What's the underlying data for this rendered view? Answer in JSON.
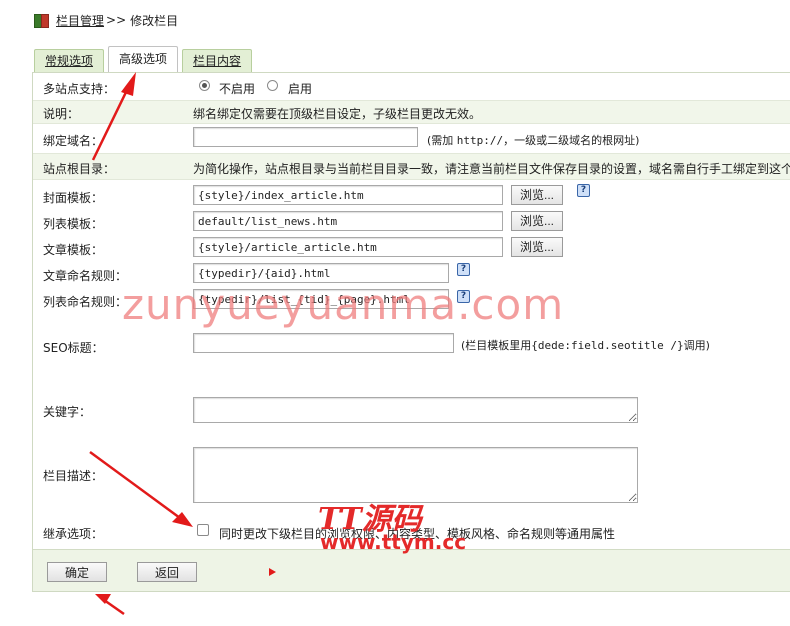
{
  "breadcrumb": {
    "parent": "栏目管理",
    "separator": ">>",
    "current": "修改栏目"
  },
  "tabs": [
    {
      "label": "常规选项"
    },
    {
      "label": "高级选项"
    },
    {
      "label": "栏目内容"
    }
  ],
  "active_tab": "高级选项",
  "form": {
    "multisite": {
      "label": "多站点支持：",
      "options": [
        "不启用",
        "启用"
      ],
      "selected": "不启用"
    },
    "note": {
      "label": "说明：",
      "text": "绑名绑定仅需要在顶级栏目设定，子级栏目更改无效。"
    },
    "bind_domain": {
      "label": "绑定域名：",
      "value": "",
      "hint_prefix": "(需加 ",
      "hint_code": "http://",
      "hint_suffix": "，一级或二级域名的根网址)"
    },
    "site_root": {
      "label": "站点根目录：",
      "text": "为简化操作，站点根目录与当前栏目目录一致，请注意当前栏目文件保存目录的设置，域名需自行手工绑定到这个"
    },
    "cover_template": {
      "label": "封面模板：",
      "value": "{style}/index_article.htm",
      "browse": "浏览..."
    },
    "list_template": {
      "label": "列表模板：",
      "value": "default/list_news.htm",
      "browse": "浏览..."
    },
    "article_template": {
      "label": "文章模板：",
      "value": "{style}/article_article.htm",
      "browse": "浏览..."
    },
    "article_rule": {
      "label": "文章命名规则：",
      "value": "{typedir}/{aid}.html"
    },
    "list_rule": {
      "label": "列表命名规则：",
      "value": "{typedir}/list_{tid}_{page}.html"
    },
    "seo_title": {
      "label": "SEO标题：",
      "value": "",
      "hint_prefix": "(栏目模板里用",
      "hint_code": "{dede:field.seotitle /}",
      "hint_suffix": "调用)"
    },
    "keywords": {
      "label": "关键字：",
      "value": ""
    },
    "description": {
      "label": "栏目描述：",
      "value": ""
    },
    "inherit": {
      "label": "继承选项：",
      "checked": false,
      "text": "同时更改下级栏目的浏览权限、内容类型、模板风格、命名规则等通用属性"
    }
  },
  "buttons": {
    "confirm": "确定",
    "back": "返回"
  },
  "watermark": "zunyueyuanma.com",
  "ttym_logo": "TT源码",
  "ttym_url": "www.ttym.cc",
  "colors": {
    "tab_bg": "#e3efd5",
    "row_shade": "#f1f6ea",
    "arrow": "#e21a1a",
    "watermark": "#ee7878"
  },
  "icons": {
    "help": "help-icon",
    "breadcrumb": "book-icon",
    "next": "play-icon"
  }
}
